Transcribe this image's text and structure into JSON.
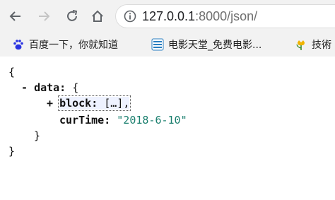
{
  "browser": {
    "url_host": "127.0.0.1",
    "url_rest": ":8000/json/"
  },
  "bookmarks": [
    {
      "label": "百度一下，你就知道",
      "icon": "baidu-paw-icon"
    },
    {
      "label": "电影天堂_免费电影...",
      "icon": "movie-heaven-icon"
    },
    {
      "label": "技術",
      "icon": "tulip-icon"
    }
  ],
  "json_view": {
    "open_root": "{",
    "collapse_toggle": "-",
    "data_key": "data:",
    "data_open": "{",
    "expand_toggle": "+",
    "block_key": "block:",
    "block_value": "[…],",
    "curtime_key": "curTime:",
    "curtime_value": "\"2018-6-10\"",
    "data_close": "}",
    "close_root": "}"
  },
  "colors": {
    "string_value": "#1a7f6e",
    "toolbar_bg": "#f2f2f2"
  }
}
